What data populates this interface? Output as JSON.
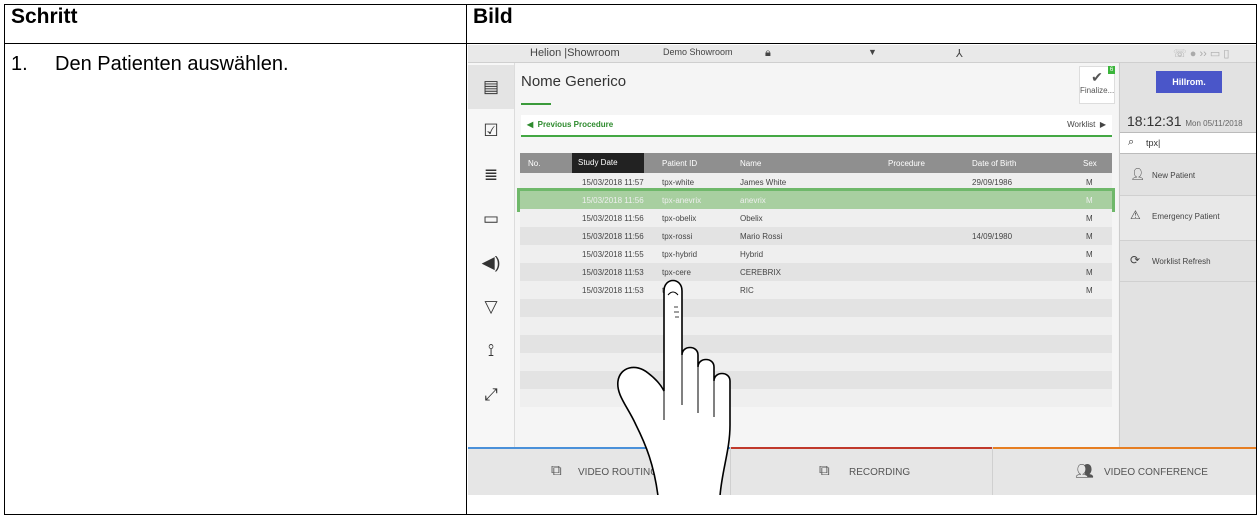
{
  "table": {
    "col_step": "Schritt",
    "col_image": "Bild",
    "step_number": "1.",
    "step_text": "Den Patienten auswählen."
  },
  "ui": {
    "topbar": {
      "site": "Helion |Showroom",
      "room": "Demo Showroom"
    },
    "title": "Nome Generico",
    "finalize": "Finalize...",
    "finalize_badge": "6",
    "nav": {
      "prev": "Previous Procedure",
      "worklist": "Worklist"
    },
    "columns": [
      "No.",
      "Study Date",
      "Patient ID",
      "Name",
      "Procedure",
      "Date of Birth",
      "Sex"
    ],
    "rows": [
      {
        "date": "15/03/2018 11:57",
        "id": "tpx-white",
        "name": "James White",
        "dob": "29/09/1986",
        "sex": "M"
      },
      {
        "date": "15/03/2018 11:56",
        "id": "tpx-anevrix",
        "name": "anevrix",
        "dob": "",
        "sex": "M"
      },
      {
        "date": "15/03/2018 11:56",
        "id": "tpx-obelix",
        "name": "Obelix",
        "dob": "",
        "sex": "M"
      },
      {
        "date": "15/03/2018 11:56",
        "id": "tpx-rossi",
        "name": "Mario Rossi",
        "dob": "14/09/1980",
        "sex": "M"
      },
      {
        "date": "15/03/2018 11:55",
        "id": "tpx-hybrid",
        "name": "Hybrid",
        "dob": "",
        "sex": "M"
      },
      {
        "date": "15/03/2018 11:53",
        "id": "tpx-cere",
        "name": "CEREBRIX",
        "dob": "",
        "sex": "M"
      },
      {
        "date": "15/03/2018 11:53",
        "id": "tpx",
        "name": "RIC",
        "dob": "",
        "sex": "M"
      }
    ],
    "logo": "Hillrom.",
    "time": "18:12:31",
    "date": "Mon 05/11/2018",
    "search_value": "tpx|",
    "actions": [
      "New Patient",
      "Emergency Patient",
      "Worklist Refresh"
    ],
    "bottom": [
      "VIDEO ROUTING",
      "RECORDING",
      "VIDEO CONFERENCE"
    ],
    "colors": {
      "routing": "#4a90d9",
      "recording": "#c0392b",
      "conference": "#e67e22",
      "accent": "#3a9a3a"
    }
  }
}
